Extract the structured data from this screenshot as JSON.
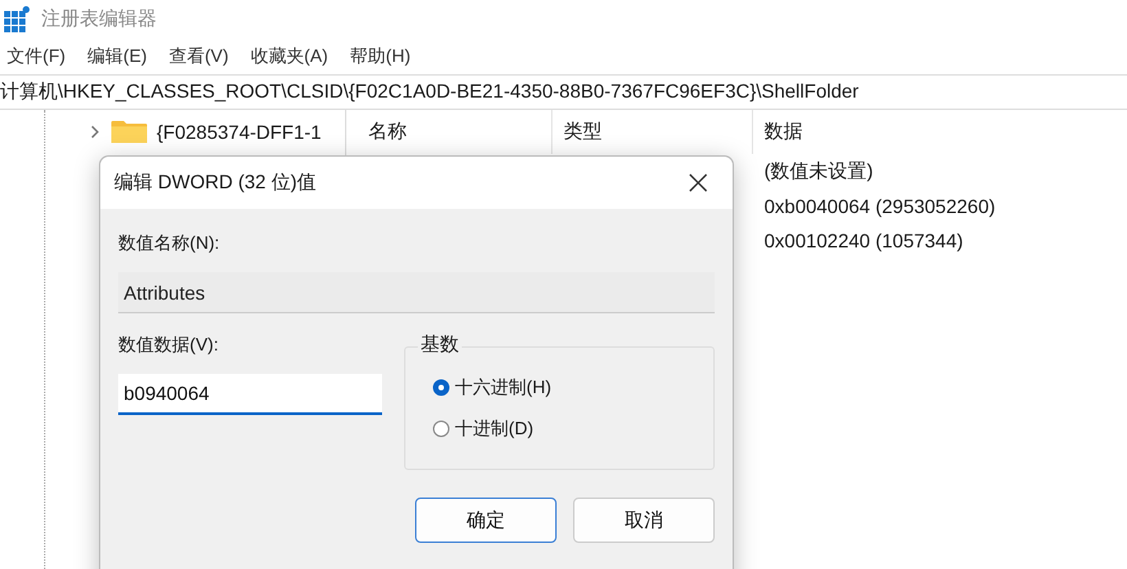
{
  "window": {
    "title": "注册表编辑器"
  },
  "menu": [
    "文件(F)",
    "编辑(E)",
    "查看(V)",
    "收藏夹(A)",
    "帮助(H)"
  ],
  "address": "计算机\\HKEY_CLASSES_ROOT\\CLSID\\{F02C1A0D-BE21-4350-88B0-7367FC96EF3C}\\ShellFolder",
  "tree": [
    {
      "label": "{F0285374-DFF1-1",
      "expanded": false
    }
  ],
  "list": {
    "columns": [
      "名称",
      "类型",
      "数据"
    ],
    "rows": [
      {
        "data": "(数值未设置)"
      },
      {
        "data": "0xb0040064 (2953052260)"
      },
      {
        "data": "0x00102240 (1057344)"
      }
    ]
  },
  "dialog": {
    "title": "编辑 DWORD (32 位)值",
    "value_name_label": "数值名称(N):",
    "value_name": "Attributes",
    "value_data_label": "数值数据(V):",
    "value_data": "b0940064",
    "base": {
      "title": "基数",
      "options": [
        {
          "label": "十六进制(H)",
          "selected": true
        },
        {
          "label": "十进制(D)",
          "selected": false
        }
      ]
    },
    "buttons": [
      {
        "label": "确定",
        "default": true
      },
      {
        "label": "取消",
        "default": false
      }
    ]
  }
}
